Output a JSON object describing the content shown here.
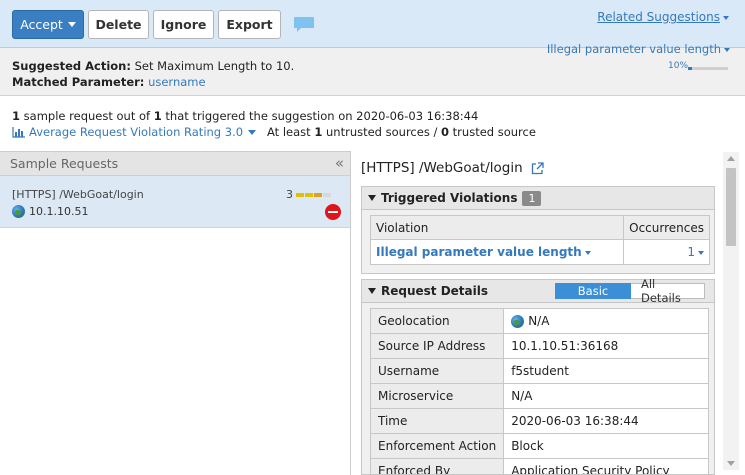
{
  "toolbar": {
    "accept_label": "Accept",
    "delete_label": "Delete",
    "ignore_label": "Ignore",
    "export_label": "Export",
    "related_suggestions": "Related Suggestions",
    "accent_color": "#3a7fc1"
  },
  "suggestion": {
    "action_label": "Suggested Action:",
    "action_value": "Set Maximum Length to 10.",
    "param_label": "Matched Parameter:",
    "param_value": "username",
    "violation_dropdown": "Illegal parameter value length",
    "percent": "10%",
    "percent_fill": 0.1
  },
  "summary": {
    "count": "1",
    "text_a": " sample request out of ",
    "total": "1",
    "text_b": " that triggered the suggestion on 2020-06-03 16:38:44",
    "avg_rating": "Average Request Violation Rating 3.0",
    "text_c": "At least ",
    "untrusted": "1",
    "text_d": " untrusted sources / ",
    "trusted": "0",
    "text_e": " trusted source"
  },
  "left_pane": {
    "title": "Sample Requests",
    "collapse": "«",
    "items": [
      {
        "url": "[HTTPS] /WebGoat/login",
        "ip": "10.1.10.51",
        "rating": "3",
        "rating_colors": [
          "#e0c000",
          "#e0c000",
          "#e0a020",
          "#d8d8d8"
        ]
      }
    ]
  },
  "right_pane": {
    "title": "[HTTPS] /WebGoat/login",
    "violations": {
      "title": "Triggered Violations",
      "count": "1",
      "headers": [
        "Violation",
        "Occurrences"
      ],
      "rows": [
        {
          "violation": "Illegal parameter value length",
          "occurrences": "1"
        }
      ]
    },
    "details": {
      "title": "Request Details",
      "tab_basic": "Basic",
      "tab_all": "All Details",
      "rows": [
        {
          "key": "Geolocation",
          "value": "N/A"
        },
        {
          "key": "Source IP Address",
          "value": "10.1.10.51:36168"
        },
        {
          "key": "Username",
          "value": "f5student"
        },
        {
          "key": "Microservice",
          "value": "N/A"
        },
        {
          "key": "Time",
          "value": "2020-06-03 16:38:44"
        },
        {
          "key": "Enforcement Action",
          "value": "Block"
        },
        {
          "key": "Enforced By",
          "value": "Application Security Policy"
        }
      ]
    }
  }
}
